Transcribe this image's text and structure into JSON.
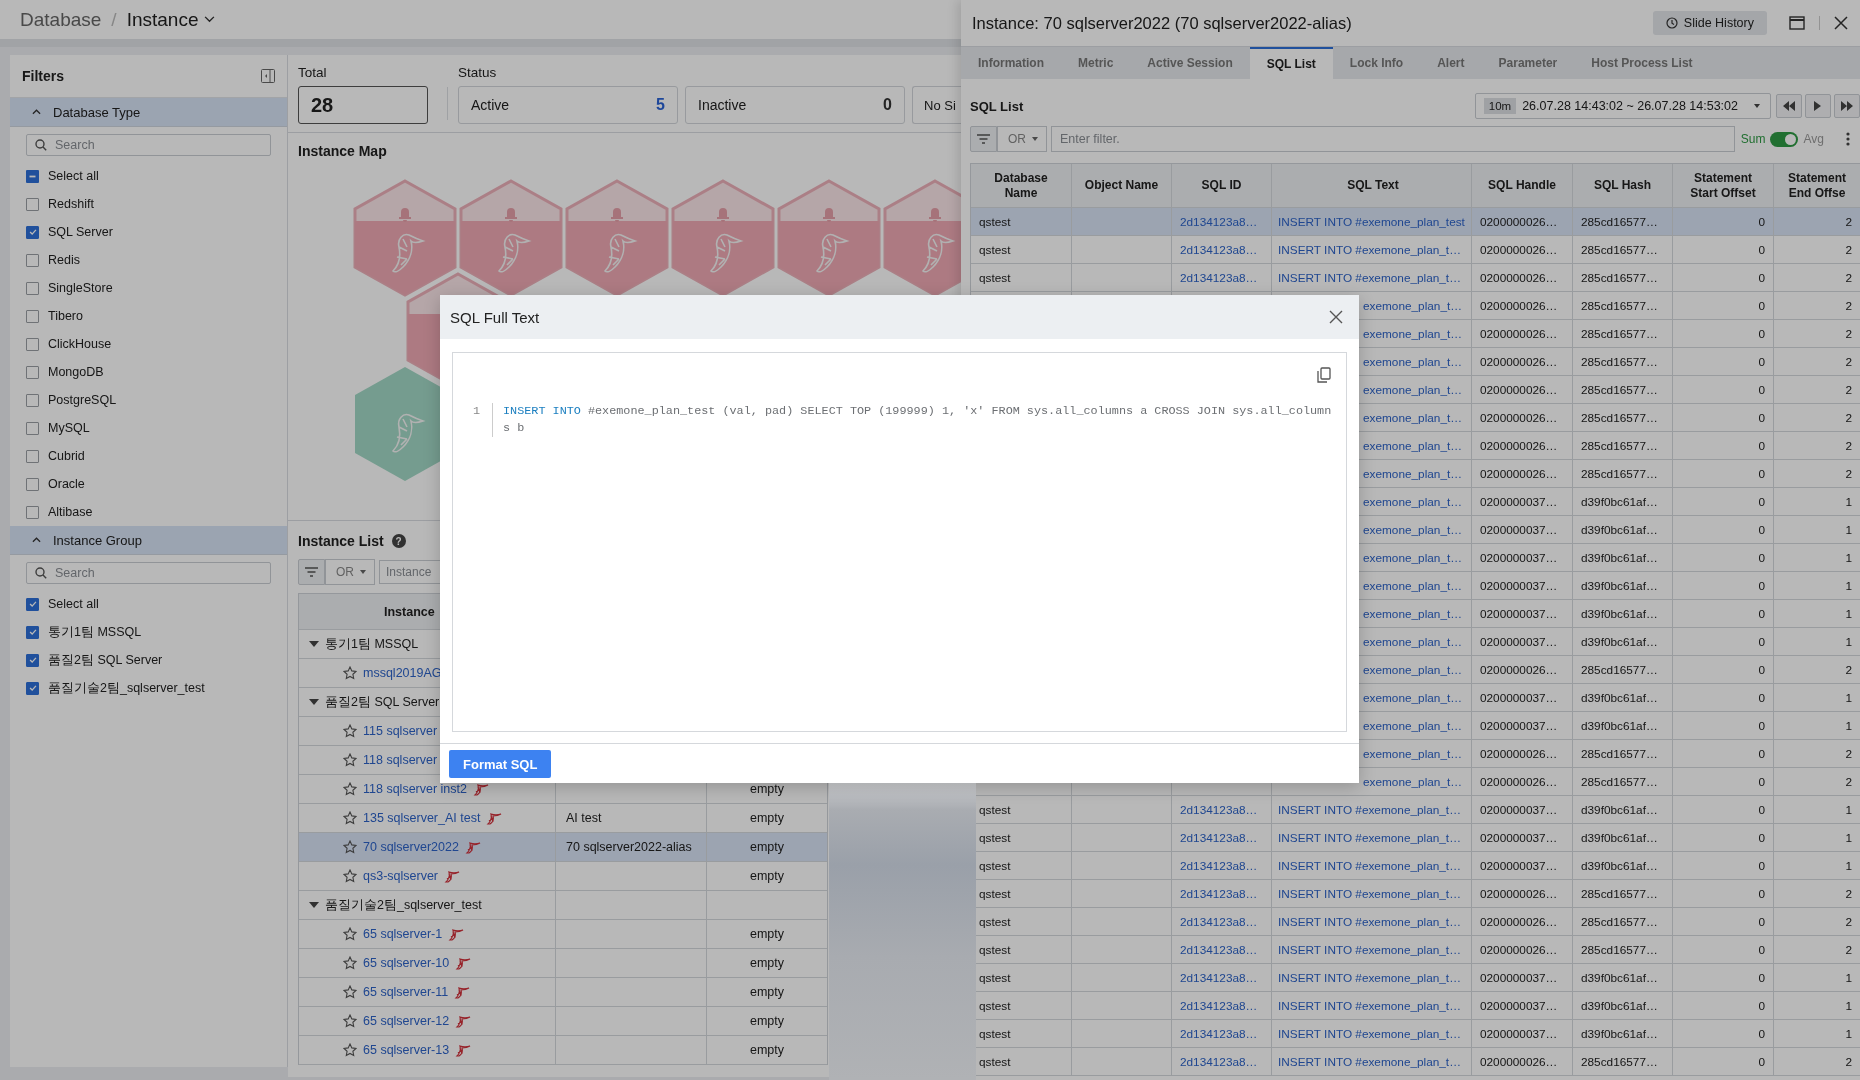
{
  "breadcrumb": {
    "parent": "Database",
    "separator": "/",
    "current": "Instance"
  },
  "filters": {
    "title": "Filters",
    "sections": [
      {
        "title": "Database Type",
        "expanded": true,
        "search_placeholder": "Search",
        "items": [
          {
            "label": "Select all",
            "checked": false,
            "partial": true
          },
          {
            "label": "Redshift",
            "checked": false,
            "partial": false
          },
          {
            "label": "SQL Server",
            "checked": true,
            "partial": false
          },
          {
            "label": "Redis",
            "checked": false,
            "partial": false
          },
          {
            "label": "SingleStore",
            "checked": false,
            "partial": false
          },
          {
            "label": "Tibero",
            "checked": false,
            "partial": false
          },
          {
            "label": "ClickHouse",
            "checked": false,
            "partial": false
          },
          {
            "label": "MongoDB",
            "checked": false,
            "partial": false
          },
          {
            "label": "PostgreSQL",
            "checked": false,
            "partial": false
          },
          {
            "label": "MySQL",
            "checked": false,
            "partial": false
          },
          {
            "label": "Cubrid",
            "checked": false,
            "partial": false
          },
          {
            "label": "Oracle",
            "checked": false,
            "partial": false
          },
          {
            "label": "Altibase",
            "checked": false,
            "partial": false
          }
        ]
      },
      {
        "title": "Instance Group",
        "expanded": true,
        "search_placeholder": "Search",
        "items": [
          {
            "label": "Select all",
            "checked": true,
            "partial": false
          },
          {
            "label": "통기1팀 MSSQL",
            "checked": true,
            "partial": false
          },
          {
            "label": "품질2팀 SQL Server",
            "checked": true,
            "partial": false
          },
          {
            "label": "품질기술2팀_sqlserver_test",
            "checked": true,
            "partial": false
          }
        ]
      }
    ]
  },
  "summary": {
    "total_label": "Total",
    "total": "28",
    "status_label": "Status",
    "statuses": [
      {
        "label": "Active",
        "count": "5",
        "highlight": true
      },
      {
        "label": "Inactive",
        "count": "0",
        "highlight": false
      },
      {
        "label": "No Si"
      }
    ]
  },
  "instance_map": {
    "title": "Instance Map",
    "rows": [
      [
        {
          "kind": "alert"
        },
        {
          "kind": "alert"
        },
        {
          "kind": "alert"
        },
        {
          "kind": "alert"
        },
        {
          "kind": "alert"
        },
        {
          "kind": "alert"
        }
      ],
      [
        {
          "kind": "alert"
        }
      ],
      [
        {
          "kind": "normal"
        }
      ]
    ]
  },
  "instance_list": {
    "title": "Instance List",
    "help": "?",
    "filter": {
      "operator": "OR",
      "placeholder": "Instance"
    },
    "columns": [
      "Instance"
    ],
    "groups": [
      {
        "name": "통기1팀 MSSQL",
        "expanded": true,
        "children": [
          {
            "name": "mssql2019AG",
            "favorite": false,
            "logo": false,
            "selected": false
          }
        ]
      },
      {
        "name": "품질2팀 SQL Server",
        "expanded": true,
        "children": [
          {
            "name": "115 sqlserver",
            "favorite": false,
            "logo": false,
            "selected": false
          },
          {
            "name": "118 sqlserver",
            "favorite": false,
            "logo": false,
            "selected": false
          },
          {
            "name": "118 sqlserver inst2",
            "status": "empty",
            "favorite": false,
            "logo": true,
            "selected": false
          },
          {
            "name": "135 sqlserver_AI test",
            "alias": "AI test",
            "status": "empty",
            "favorite": false,
            "logo": true,
            "selected": false
          },
          {
            "name": "70 sqlserver2022",
            "alias": "70 sqlserver2022-alias",
            "status": "empty",
            "favorite": false,
            "logo": true,
            "selected": true
          },
          {
            "name": "qs3-sqlserver",
            "status": "empty",
            "favorite": false,
            "logo": true,
            "selected": false
          }
        ]
      },
      {
        "name": "품질기술2팀_sqlserver_test",
        "expanded": true,
        "children": [
          {
            "name": "65 sqlserver-1",
            "status": "empty",
            "favorite": false,
            "logo": true,
            "selected": false
          },
          {
            "name": "65 sqlserver-10",
            "status": "empty",
            "favorite": false,
            "logo": true,
            "selected": false
          },
          {
            "name": "65 sqlserver-11",
            "status": "empty",
            "favorite": false,
            "logo": true,
            "selected": false
          },
          {
            "name": "65 sqlserver-12",
            "status": "empty",
            "favorite": false,
            "logo": true,
            "selected": false
          },
          {
            "name": "65 sqlserver-13",
            "status": "empty",
            "favorite": false,
            "logo": true,
            "selected": false
          }
        ]
      }
    ]
  },
  "detail_panel": {
    "title": "Instance: 70 sqlserver2022 (70 sqlserver2022-alias)",
    "history_button": "Slide History",
    "tabs": [
      {
        "label": "Information",
        "selected": false
      },
      {
        "label": "Metric",
        "selected": false
      },
      {
        "label": "Active Session",
        "selected": false
      },
      {
        "label": "SQL List",
        "selected": true
      },
      {
        "label": "Lock Info",
        "selected": false
      },
      {
        "label": "Alert",
        "selected": false
      },
      {
        "label": "Parameter",
        "selected": false
      },
      {
        "label": "Host Process List",
        "selected": false
      }
    ],
    "section_title": "SQL List",
    "range": {
      "preset": "10m",
      "text": "26.07.28 14:43:02 ~ 26.07.28 14:53:02"
    },
    "filter": {
      "operator": "OR",
      "placeholder": "Enter filter."
    },
    "aggregate": {
      "left": "Sum",
      "right": "Avg",
      "on": true
    },
    "table": {
      "columns": [
        "Database Name",
        "Object Name",
        "SQL ID",
        "SQL Text",
        "SQL Handle",
        "SQL Hash",
        "Statement Start Offset",
        "Statement End Offse"
      ],
      "rows": [
        {
          "kind": "full",
          "selected": true,
          "database": "qstest",
          "sql_id": "2d134123a8…",
          "sql_text": "INSERT INTO #exemone_plan_test",
          "handle": "0200000026…",
          "hash": "285cd16577…",
          "start": "0",
          "end": "2"
        },
        {
          "kind": "full",
          "selected": false,
          "database": "qstest",
          "sql_id": "2d134123a8…",
          "sql_text": "INSERT INTO #exemone_plan_t…",
          "handle": "0200000026…",
          "hash": "285cd16577…",
          "start": "0",
          "end": "2"
        },
        {
          "kind": "full",
          "selected": false,
          "database": "qstest",
          "sql_id": "2d134123a8…",
          "sql_text": "INSERT INTO #exemone_plan_t…",
          "handle": "0200000026…",
          "hash": "285cd16577…",
          "start": "0",
          "end": "2"
        },
        {
          "kind": "covered",
          "selected": false,
          "sql_text": "exemone_plan_t…",
          "handle": "0200000026…",
          "hash": "285cd16577…",
          "start": "0",
          "end": "2"
        },
        {
          "kind": "covered",
          "selected": false,
          "sql_text": "exemone_plan_t…",
          "handle": "0200000026…",
          "hash": "285cd16577…",
          "start": "0",
          "end": "2"
        },
        {
          "kind": "covered",
          "selected": false,
          "sql_text": "exemone_plan_t…",
          "handle": "0200000026…",
          "hash": "285cd16577…",
          "start": "0",
          "end": "2"
        },
        {
          "kind": "covered",
          "selected": false,
          "sql_text": "exemone_plan_t…",
          "handle": "0200000026…",
          "hash": "285cd16577…",
          "start": "0",
          "end": "2"
        },
        {
          "kind": "covered",
          "selected": false,
          "sql_text": "exemone_plan_t…",
          "handle": "0200000026…",
          "hash": "285cd16577…",
          "start": "0",
          "end": "2"
        },
        {
          "kind": "covered",
          "selected": false,
          "sql_text": "exemone_plan_t…",
          "handle": "0200000026…",
          "hash": "285cd16577…",
          "start": "0",
          "end": "2"
        },
        {
          "kind": "covered",
          "selected": false,
          "sql_text": "exemone_plan_t…",
          "handle": "0200000026…",
          "hash": "285cd16577…",
          "start": "0",
          "end": "2"
        },
        {
          "kind": "covered",
          "selected": false,
          "sql_text": "exemone_plan_t…",
          "handle": "0200000037…",
          "hash": "d39f0bc61af…",
          "start": "0",
          "end": "1"
        },
        {
          "kind": "covered",
          "selected": false,
          "sql_text": "exemone_plan_t…",
          "handle": "0200000037…",
          "hash": "d39f0bc61af…",
          "start": "0",
          "end": "1"
        },
        {
          "kind": "covered",
          "selected": false,
          "sql_text": "exemone_plan_t…",
          "handle": "0200000037…",
          "hash": "d39f0bc61af…",
          "start": "0",
          "end": "1"
        },
        {
          "kind": "covered",
          "selected": false,
          "sql_text": "exemone_plan_t…",
          "handle": "0200000037…",
          "hash": "d39f0bc61af…",
          "start": "0",
          "end": "1"
        },
        {
          "kind": "covered",
          "selected": false,
          "sql_text": "exemone_plan_t…",
          "handle": "0200000037…",
          "hash": "d39f0bc61af…",
          "start": "0",
          "end": "1"
        },
        {
          "kind": "covered",
          "selected": false,
          "sql_text": "exemone_plan_t…",
          "handle": "0200000037…",
          "hash": "d39f0bc61af…",
          "start": "0",
          "end": "1"
        },
        {
          "kind": "covered",
          "selected": false,
          "sql_text": "exemone_plan_t…",
          "handle": "0200000026…",
          "hash": "285cd16577…",
          "start": "0",
          "end": "2"
        },
        {
          "kind": "covered",
          "selected": false,
          "sql_text": "exemone_plan_t…",
          "handle": "0200000037…",
          "hash": "d39f0bc61af…",
          "start": "0",
          "end": "1"
        },
        {
          "kind": "covered",
          "selected": false,
          "sql_text": "exemone_plan_t…",
          "handle": "0200000037…",
          "hash": "d39f0bc61af…",
          "start": "0",
          "end": "1"
        },
        {
          "kind": "covered",
          "selected": false,
          "sql_text": "exemone_plan_t…",
          "handle": "0200000026…",
          "hash": "285cd16577…",
          "start": "0",
          "end": "2"
        },
        {
          "kind": "covered",
          "selected": false,
          "sql_text": "exemone_plan_t…",
          "handle": "0200000026…",
          "hash": "285cd16577…",
          "start": "0",
          "end": "2"
        },
        {
          "kind": "full",
          "selected": false,
          "database": "qstest",
          "sql_id": "2d134123a8…",
          "sql_text": "INSERT INTO #exemone_plan_t…",
          "handle": "0200000037…",
          "hash": "d39f0bc61af…",
          "start": "0",
          "end": "1"
        },
        {
          "kind": "full",
          "selected": false,
          "database": "qstest",
          "sql_id": "2d134123a8…",
          "sql_text": "INSERT INTO #exemone_plan_t…",
          "handle": "0200000037…",
          "hash": "d39f0bc61af…",
          "start": "0",
          "end": "1"
        },
        {
          "kind": "full",
          "selected": false,
          "database": "qstest",
          "sql_id": "2d134123a8…",
          "sql_text": "INSERT INTO #exemone_plan_t…",
          "handle": "0200000037…",
          "hash": "d39f0bc61af…",
          "start": "0",
          "end": "1"
        },
        {
          "kind": "full",
          "selected": false,
          "database": "qstest",
          "sql_id": "2d134123a8…",
          "sql_text": "INSERT INTO #exemone_plan_t…",
          "handle": "0200000026…",
          "hash": "285cd16577…",
          "start": "0",
          "end": "2"
        },
        {
          "kind": "full",
          "selected": false,
          "database": "qstest",
          "sql_id": "2d134123a8…",
          "sql_text": "INSERT INTO #exemone_plan_t…",
          "handle": "0200000026…",
          "hash": "285cd16577…",
          "start": "0",
          "end": "2"
        },
        {
          "kind": "full",
          "selected": false,
          "database": "qstest",
          "sql_id": "2d134123a8…",
          "sql_text": "INSERT INTO #exemone_plan_t…",
          "handle": "0200000026…",
          "hash": "285cd16577…",
          "start": "0",
          "end": "2"
        },
        {
          "kind": "full",
          "selected": false,
          "database": "qstest",
          "sql_id": "2d134123a8…",
          "sql_text": "INSERT INTO #exemone_plan_t…",
          "handle": "0200000037…",
          "hash": "d39f0bc61af…",
          "start": "0",
          "end": "1"
        },
        {
          "kind": "full",
          "selected": false,
          "database": "qstest",
          "sql_id": "2d134123a8…",
          "sql_text": "INSERT INTO #exemone_plan_t…",
          "handle": "0200000037…",
          "hash": "d39f0bc61af…",
          "start": "0",
          "end": "1"
        },
        {
          "kind": "full",
          "selected": false,
          "database": "qstest",
          "sql_id": "2d134123a8…",
          "sql_text": "INSERT INTO #exemone_plan_t…",
          "handle": "0200000037…",
          "hash": "d39f0bc61af…",
          "start": "0",
          "end": "1"
        },
        {
          "kind": "full",
          "selected": false,
          "database": "qstest",
          "sql_id": "2d134123a8…",
          "sql_text": "INSERT INTO #exemone_plan_t…",
          "handle": "0200000026…",
          "hash": "285cd16577…",
          "start": "0",
          "end": "2"
        }
      ]
    }
  },
  "modal": {
    "title": "SQL Full Text",
    "line_number": "1",
    "code": [
      {
        "kind": "keyword",
        "text": "INSERT INTO"
      },
      {
        "kind": "plain",
        "text": " #exemone_plan_test (val, pad) SELECT TOP (199999) 1, 'x' FROM sys.all_columns a CROSS JOIN sys.all_columns b"
      }
    ],
    "format_button": "Format SQL"
  }
}
